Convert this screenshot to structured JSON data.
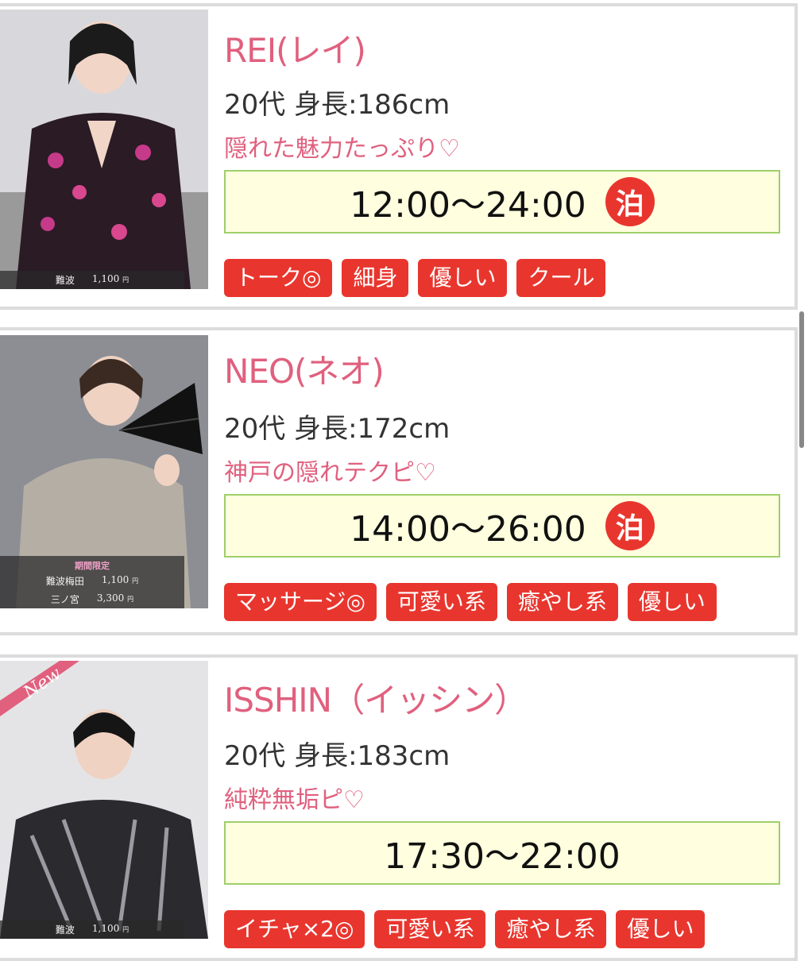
{
  "cards": [
    {
      "name": "REI(レイ)",
      "info": "20代 身長:186cm",
      "catch": "隠れた魅力たっぷり♡",
      "time": "12:00～24:00",
      "stay": "泊",
      "tags": [
        "トーク◎",
        "細身",
        "優しい",
        "クール"
      ],
      "price": {
        "area": "難波",
        "amount": "1,100",
        "yen": "円"
      }
    },
    {
      "name": "NEO(ネオ)",
      "info": "20代 身長:172cm",
      "catch": "神戸の隠れテクピ♡",
      "time": "14:00～26:00",
      "stay": "泊",
      "tags": [
        "マッサージ◎",
        "可愛い系",
        "癒やし系",
        "優しい"
      ],
      "price": {
        "label": "期間限定",
        "rows": [
          {
            "area": "難波梅田",
            "amount": "1,100",
            "yen": "円"
          },
          {
            "area": "三ノ宮",
            "amount": "3,300",
            "yen": "円"
          }
        ]
      }
    },
    {
      "name": "ISSHIN（イッシン）",
      "info": "20代 身長:183cm",
      "catch": "純粋無垢ピ♡",
      "time": "17:30～22:00",
      "new_badge": "New",
      "tags": [
        "イチャ×2◎",
        "可愛い系",
        "癒やし系",
        "優しい"
      ],
      "price": {
        "area": "難波",
        "amount": "1,100",
        "yen": "円"
      }
    }
  ],
  "colors": {
    "accent_pink": "#e0607e",
    "tag_red": "#e8362e",
    "time_bg": "#ffffdf",
    "time_border": "#9ecf6a"
  }
}
